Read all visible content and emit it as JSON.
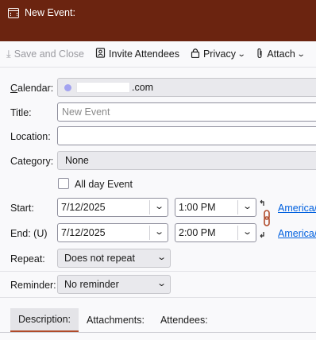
{
  "window": {
    "title": "New Event:"
  },
  "toolbar": {
    "save_close": "Save and Close",
    "invite": "Invite Attendees",
    "privacy": "Privacy",
    "attach": "Attach"
  },
  "form": {
    "calendar": {
      "label": "Calendar:",
      "value_suffix": ".com",
      "color": "#a3a3f0"
    },
    "title": {
      "label": "Title:",
      "placeholder": "New Event"
    },
    "location": {
      "label": "Location:",
      "value": ""
    },
    "category": {
      "label": "Category:",
      "value": "None"
    },
    "allday": {
      "label": "All day Event",
      "checked": false
    },
    "start": {
      "label": "Start:",
      "date": "7/12/2025",
      "time": "1:00 PM",
      "timezone": "America/"
    },
    "end": {
      "label": "End: (U)",
      "date": "7/12/2025",
      "time": "2:00 PM",
      "timezone": "America/"
    },
    "repeat": {
      "label": "Repeat:",
      "value": "Does not repeat"
    },
    "reminder": {
      "label": "Reminder:",
      "value": "No reminder"
    }
  },
  "tabs": [
    {
      "label": "Description:",
      "active": true
    },
    {
      "label": "Attachments:",
      "active": false
    },
    {
      "label": "Attendees:",
      "active": false
    }
  ],
  "colors": {
    "titlebar": "#6b2410",
    "link": "#0060df",
    "accent": "#b04a2a"
  }
}
